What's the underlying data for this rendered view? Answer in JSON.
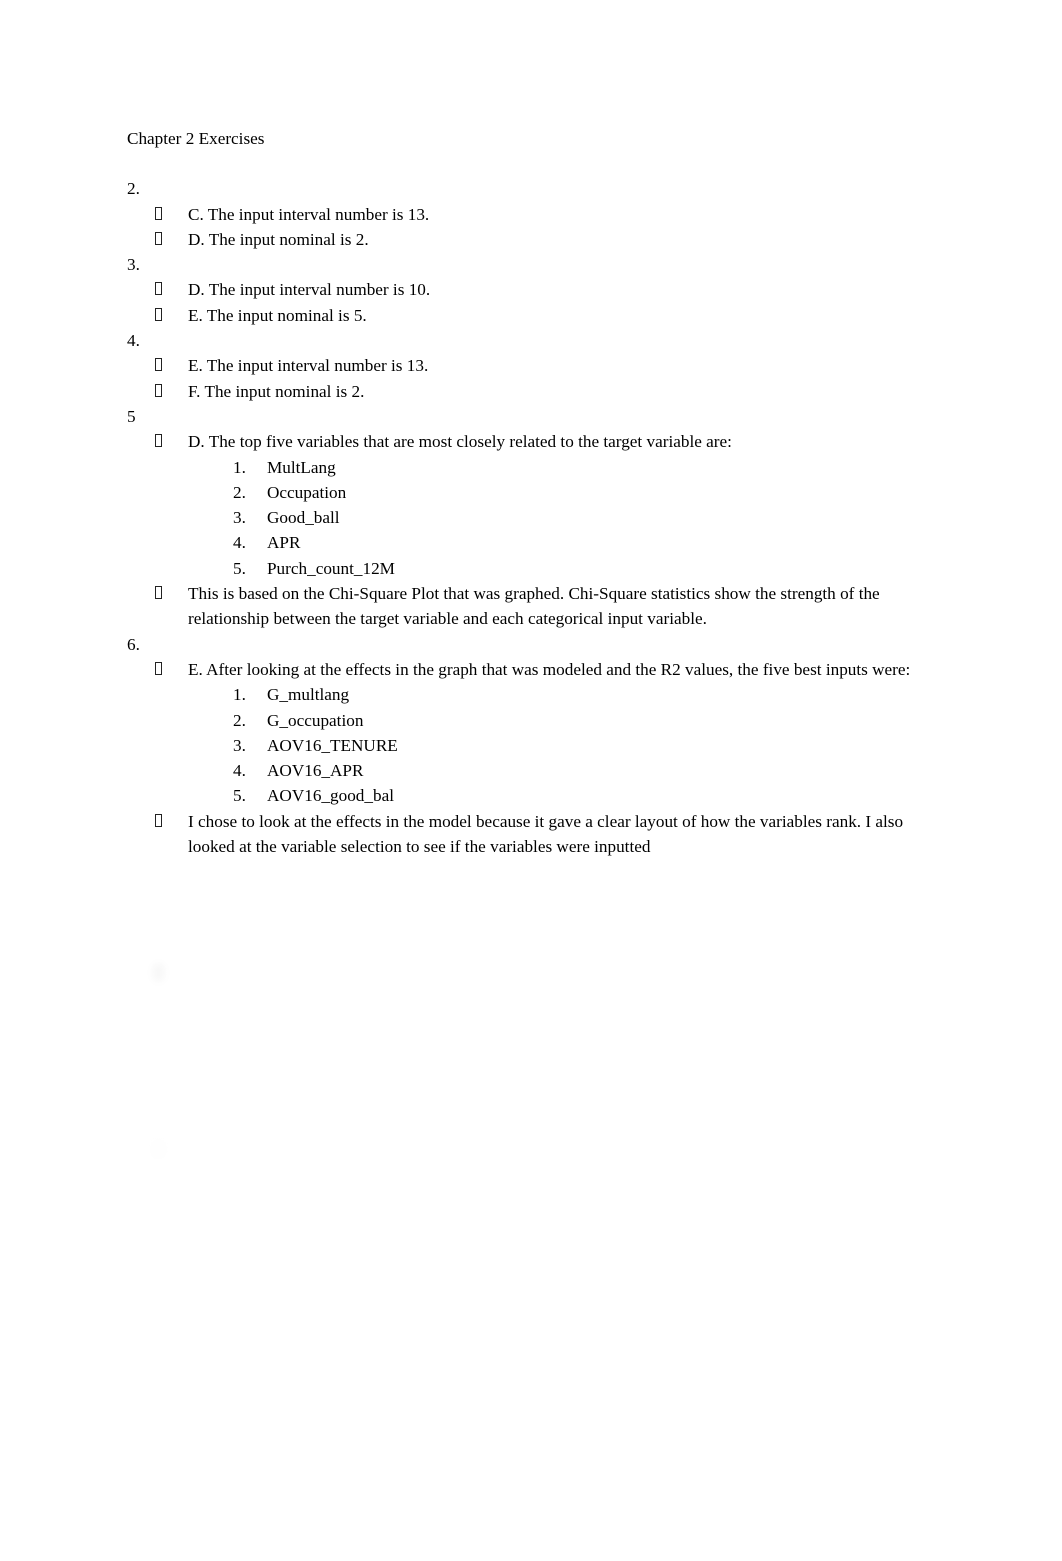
{
  "document": {
    "title": "Chapter 2 Exercises",
    "bullet_glyph": "missing-glyph-box",
    "background_color": "#ffffff",
    "text_color": "#000000"
  },
  "items": [
    {
      "marker": "2.",
      "bullets": [
        {
          "text": "C. The input interval number is 13."
        },
        {
          "text": "D. The input nominal is 2."
        }
      ]
    },
    {
      "marker": "3.",
      "bullets": [
        {
          "text": "D. The input interval number is 10."
        },
        {
          "text": "E. The input nominal is 5."
        }
      ]
    },
    {
      "marker": "4.",
      "bullets": [
        {
          "text": "E. The input interval number is 13."
        },
        {
          "text": "F. The input nominal is 2."
        }
      ]
    },
    {
      "marker": "5",
      "bullets": [
        {
          "text": "D. The top five variables that are most closely related to the target variable are:",
          "sub_list": [
            {
              "num": "1.",
              "label": "MultLang"
            },
            {
              "num": "2.",
              "label": "Occupation"
            },
            {
              "num": "3.",
              "label": "Good_ball"
            },
            {
              "num": "4.",
              "label": "APR"
            },
            {
              "num": "5.",
              "label": "Purch_count_12M"
            }
          ]
        },
        {
          "text": "This is based on the Chi-Square Plot that was graphed. Chi-Square statistics show the strength of the relationship between the target variable and each categorical input variable."
        }
      ]
    },
    {
      "marker": "6.",
      "bullets": [
        {
          "text": "E. After looking at the effects in the graph that was modeled and the R2 values, the five best inputs were:",
          "sub_list": [
            {
              "num": "1.",
              "label": "G_multlang"
            },
            {
              "num": "2.",
              "label": "G_occupation"
            },
            {
              "num": "3.",
              "label": "AOV16_TENURE"
            },
            {
              "num": "4.",
              "label": "AOV16_APR"
            },
            {
              "num": "5.",
              "label": "AOV16_good_bal"
            }
          ]
        },
        {
          "text": "I chose to look at the effects in the model because it gave a clear layout of how the variables rank. I also looked at the variable selection to see if the variables were inputted"
        }
      ]
    }
  ],
  "faded": {
    "note": "Lower portion of the page is blurred and illegible in the screenshot.",
    "continuation_lines": [
      " ",
      " ",
      " "
    ],
    "marker": " ",
    "bullet_lines": [
      " ",
      " "
    ],
    "sub_list": [
      {
        "num": " ",
        "label": " "
      },
      {
        "num": " ",
        "label": " "
      },
      {
        "num": " ",
        "label": " "
      },
      {
        "num": " ",
        "label": " "
      },
      {
        "num": " ",
        "label": " "
      }
    ],
    "closing_lines": [
      " ",
      " "
    ]
  }
}
